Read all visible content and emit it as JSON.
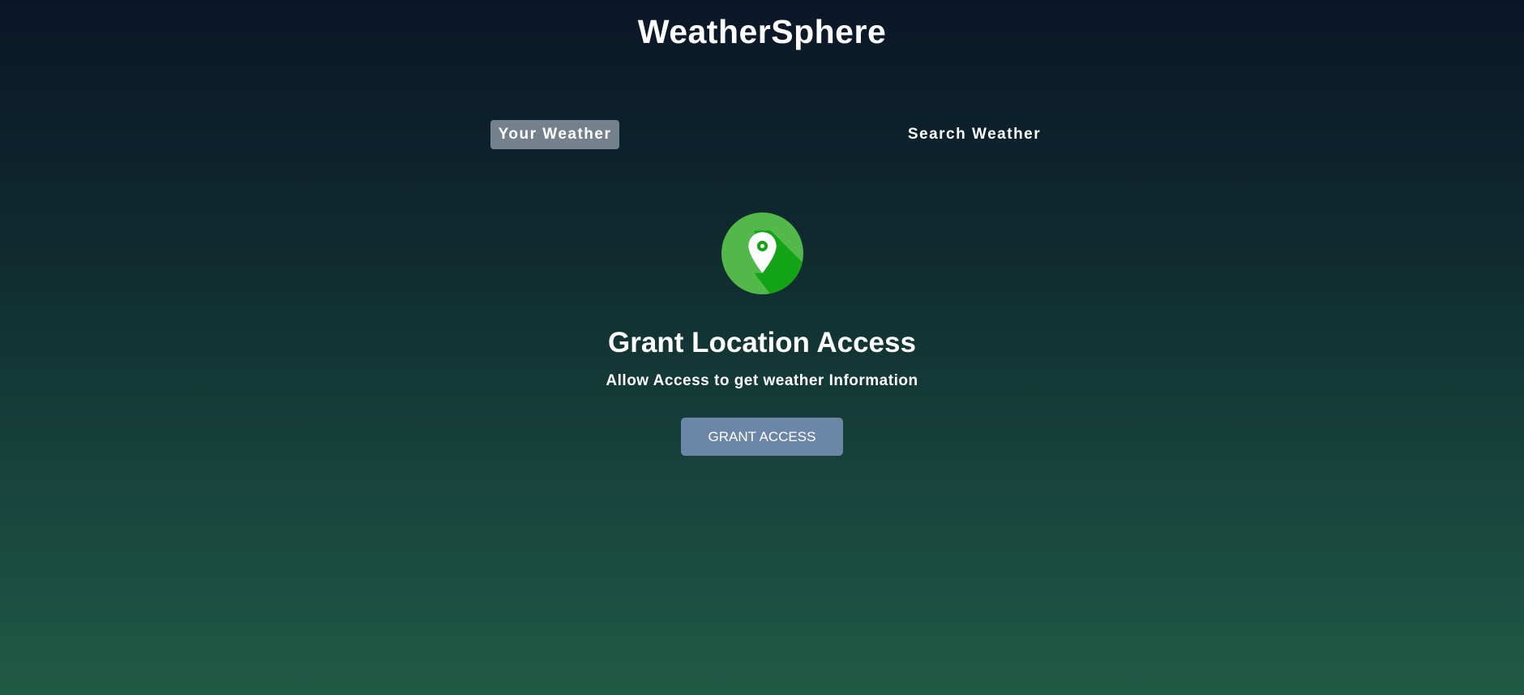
{
  "app": {
    "title": "WeatherSphere"
  },
  "tabs": [
    {
      "label": "Your Weather",
      "active": true
    },
    {
      "label": "Search Weather",
      "active": false
    }
  ],
  "grant": {
    "icon": "location-pin-icon",
    "heading": "Grant Location Access",
    "subtext": "Allow Access to get weather Information",
    "button_label": "GRANT ACCESS"
  },
  "colors": {
    "background_top": "#0a1628",
    "background_bottom": "#1f5a44",
    "active_tab": "#7a8595",
    "button": "#6b86a6",
    "icon_circle": "#53b84a",
    "icon_shadow": "#13a317"
  }
}
